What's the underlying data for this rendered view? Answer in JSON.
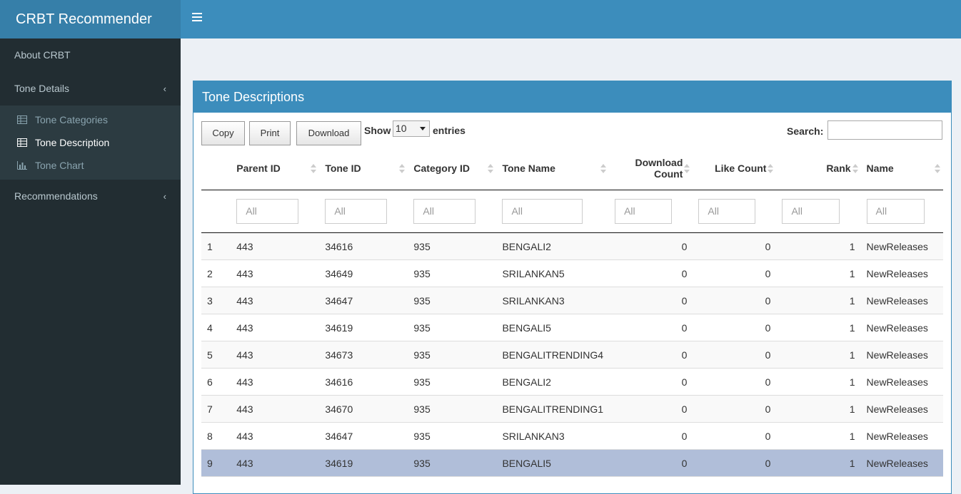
{
  "app": {
    "title": "CRBT Recommender"
  },
  "sidebar": {
    "items": [
      {
        "label": "About CRBT"
      },
      {
        "label": "Tone Details",
        "chevron": "‹",
        "children": [
          {
            "label": "Tone Categories",
            "icon": "table-icon"
          },
          {
            "label": "Tone Description",
            "icon": "table-icon",
            "active": true
          },
          {
            "label": "Tone Chart",
            "icon": "bar-chart-icon"
          }
        ]
      },
      {
        "label": "Recommendations",
        "chevron": "‹"
      }
    ]
  },
  "box": {
    "title": "Tone Descriptions",
    "buttons": {
      "copy": "Copy",
      "print": "Print",
      "download": "Download"
    },
    "show_label": "Show",
    "page_length": "10",
    "entries_label": "entries",
    "search_label": "Search:",
    "search_value": "",
    "filter_placeholder": "All"
  },
  "table": {
    "headers": [
      "",
      "Parent ID",
      "Tone ID",
      "Category ID",
      "Tone Name",
      "Download Count",
      "Like Count",
      "Rank",
      "Name"
    ],
    "rows": [
      [
        "1",
        "443",
        "34616",
        "935",
        "BENGALI2",
        "0",
        "0",
        "1",
        "NewReleases"
      ],
      [
        "2",
        "443",
        "34649",
        "935",
        "SRILANKAN5",
        "0",
        "0",
        "1",
        "NewReleases"
      ],
      [
        "3",
        "443",
        "34647",
        "935",
        "SRILANKAN3",
        "0",
        "0",
        "1",
        "NewReleases"
      ],
      [
        "4",
        "443",
        "34619",
        "935",
        "BENGALI5",
        "0",
        "0",
        "1",
        "NewReleases"
      ],
      [
        "5",
        "443",
        "34673",
        "935",
        "BENGALITRENDING4",
        "0",
        "0",
        "1",
        "NewReleases"
      ],
      [
        "6",
        "443",
        "34616",
        "935",
        "BENGALI2",
        "0",
        "0",
        "1",
        "NewReleases"
      ],
      [
        "7",
        "443",
        "34670",
        "935",
        "BENGALITRENDING1",
        "0",
        "0",
        "1",
        "NewReleases"
      ],
      [
        "8",
        "443",
        "34647",
        "935",
        "SRILANKAN3",
        "0",
        "0",
        "1",
        "NewReleases"
      ],
      [
        "9",
        "443",
        "34619",
        "935",
        "BENGALI5",
        "0",
        "0",
        "1",
        "NewReleases"
      ]
    ],
    "selected_row": 9
  }
}
